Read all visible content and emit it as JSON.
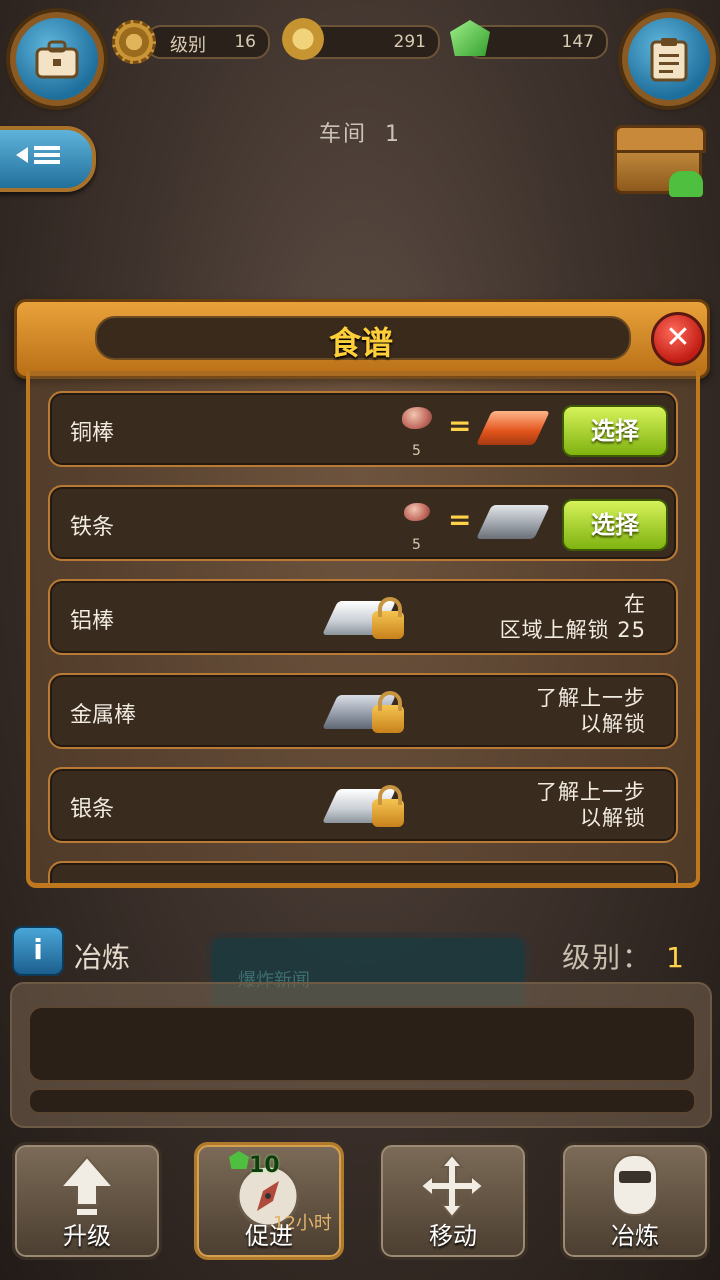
{
  "top_bar": {
    "level_label": "级别",
    "level_value": "16",
    "coins_value": "291",
    "gems_value": "147"
  },
  "workshop": {
    "title": "车间",
    "number": "1"
  },
  "recipe_panel": {
    "title": "食谱",
    "close_symbol": "✕",
    "rows": [
      {
        "name": "铜棒",
        "ore_qty": "5",
        "button": "选择"
      },
      {
        "name": "铁条",
        "ore_qty": "5",
        "button": "选择"
      },
      {
        "name": "铝棒",
        "unlock_line1": "在",
        "unlock_line2": "区域上解锁 25"
      },
      {
        "name": "金属棒",
        "unlock_line1": "了解上一步",
        "unlock_line2": "以解锁"
      },
      {
        "name": "银条",
        "unlock_line1": "了解上一步",
        "unlock_line2": "以解锁"
      }
    ],
    "equals": "="
  },
  "info": {
    "icon": "i",
    "name": "冶炼",
    "level_label": "级别：",
    "level_value": "1",
    "screen_text": "爆炸新闻"
  },
  "bottom_nav": {
    "upgrade": "升级",
    "boost": "促进",
    "boost_gems": "10",
    "boost_time": "12小时",
    "move": "移动",
    "smelt": "冶炼"
  },
  "colors": {
    "accent_orange": "#e9a23a",
    "title_yellow": "#ffcf3a",
    "select_green": "#9fd01e",
    "blue_button": "#2f86b8"
  }
}
